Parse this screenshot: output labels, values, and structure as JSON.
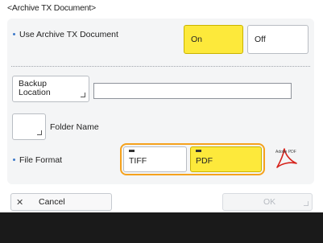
{
  "title": "<Archive TX Document>",
  "use_archive": {
    "label": "Use Archive TX Document",
    "on_label": "On",
    "off_label": "Off",
    "selected": "On"
  },
  "backup_location": {
    "button_label_line1": "Backup",
    "button_label_line2": "Location",
    "value": ""
  },
  "folder_name": {
    "label": "Folder Name"
  },
  "file_format": {
    "label": "File Format",
    "options": [
      "TIFF",
      "PDF"
    ],
    "selected": "PDF"
  },
  "pdf_logo_text": "Adobe PDF",
  "footer": {
    "cancel_label": "Cancel",
    "ok_label": "OK"
  },
  "colors": {
    "selected": "#fde93b",
    "focus_ring": "#f5a21d",
    "bullet": "#3d78c8"
  }
}
